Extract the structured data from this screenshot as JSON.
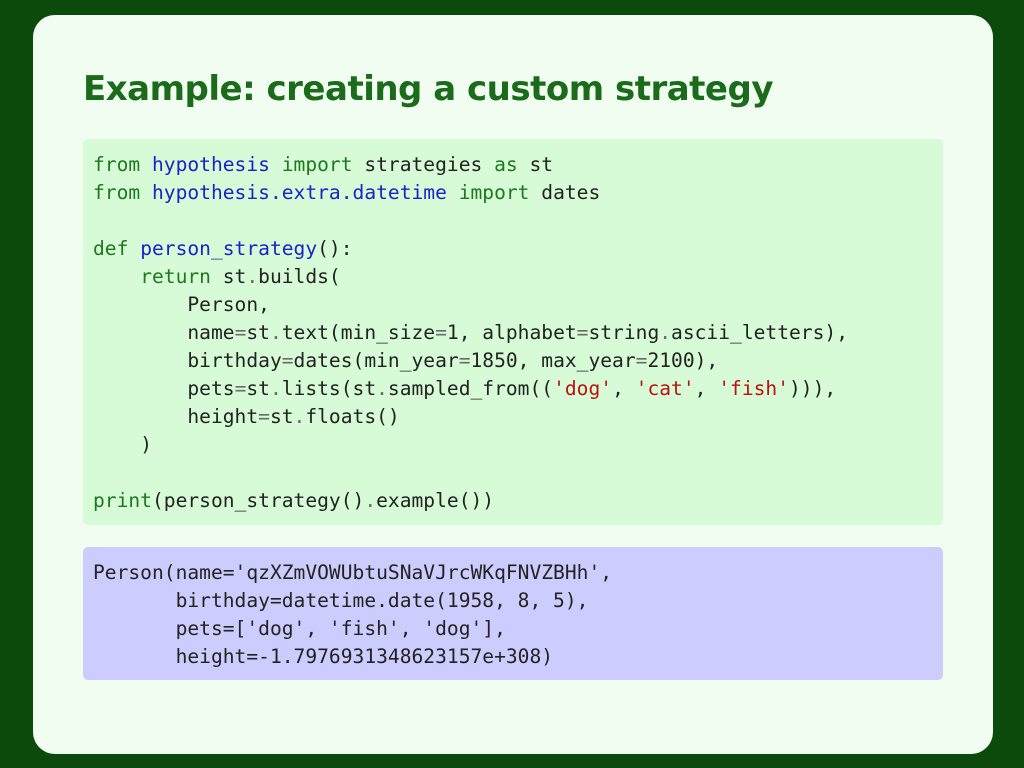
{
  "slide": {
    "title": "Example: creating a custom strategy"
  },
  "code": {
    "line1": {
      "k1": "from",
      "m1": "hypothesis",
      "k2": "import",
      "t1": "strategies",
      "k3": "as",
      "t2": "st"
    },
    "line2": {
      "k1": "from",
      "m1": "hypothesis.extra.datetime",
      "k2": "import",
      "t1": "dates"
    },
    "line4": {
      "k1": "def",
      "f1": "person_strategy",
      "t1": "():"
    },
    "line5": {
      "k1": "return",
      "t1": "st",
      "o1": ".",
      "t2": "builds("
    },
    "line6": {
      "t1": "Person,"
    },
    "line7": {
      "t1": "name",
      "o1": "=",
      "t2": "st",
      "o2": ".",
      "t3": "text(min_size",
      "o3": "=",
      "t4": "1, alphabet",
      "o4": "=",
      "t5": "string",
      "o5": ".",
      "t6": "ascii_letters),"
    },
    "line8": {
      "t1": "birthday",
      "o1": "=",
      "t2": "dates(min_year",
      "o2": "=",
      "t3": "1850, max_year",
      "o3": "=",
      "t4": "2100),"
    },
    "line9": {
      "t1": "pets",
      "o1": "=",
      "t2": "st",
      "o2": ".",
      "t3": "lists(st",
      "o3": ".",
      "t4": "sampled_from((",
      "s1": "'dog'",
      "t5": ", ",
      "s2": "'cat'",
      "t6": ", ",
      "s3": "'fish'",
      "t7": "))),"
    },
    "line10": {
      "t1": "height",
      "o1": "=",
      "t2": "st",
      "o2": ".",
      "t3": "floats()"
    },
    "line11": {
      "t1": ")"
    },
    "line13": {
      "b1": "print",
      "t1": "(person_strategy()",
      "o1": ".",
      "t2": "example())"
    }
  },
  "output": {
    "lines": [
      "Person(name='qzXZmVOWUbtuSNaVJrcWKqFNVZBHh',",
      "       birthday=datetime.date(1958, 8, 5),",
      "       pets=['dog', 'fish', 'dog'],",
      "       height=-1.7976931348623157e+308)"
    ]
  },
  "colors": {
    "background": "#0b4a0b",
    "slide": "#f2fdf2",
    "title": "#1a6b1a",
    "code_bg": "#d6fbd6",
    "output_bg": "#ccccff",
    "keyword": "#1c7a1c",
    "module": "#1a22c8",
    "string": "#bb1111"
  }
}
